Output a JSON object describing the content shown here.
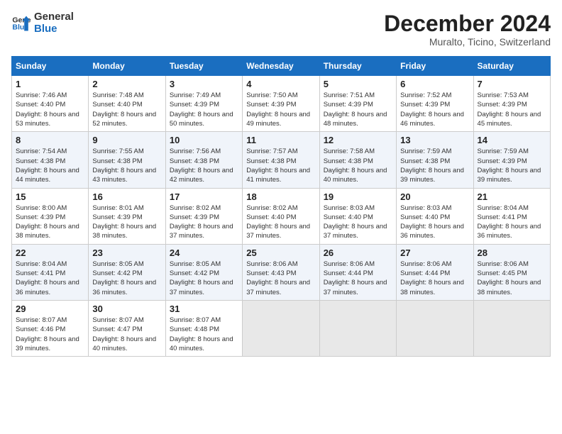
{
  "header": {
    "logo_line1": "General",
    "logo_line2": "Blue",
    "month": "December 2024",
    "location": "Muralto, Ticino, Switzerland"
  },
  "days_of_week": [
    "Sunday",
    "Monday",
    "Tuesday",
    "Wednesday",
    "Thursday",
    "Friday",
    "Saturday"
  ],
  "weeks": [
    [
      {
        "day": 1,
        "sunrise": "7:46 AM",
        "sunset": "4:40 PM",
        "daylight": "8 hours and 53 minutes."
      },
      {
        "day": 2,
        "sunrise": "7:48 AM",
        "sunset": "4:40 PM",
        "daylight": "8 hours and 52 minutes."
      },
      {
        "day": 3,
        "sunrise": "7:49 AM",
        "sunset": "4:39 PM",
        "daylight": "8 hours and 50 minutes."
      },
      {
        "day": 4,
        "sunrise": "7:50 AM",
        "sunset": "4:39 PM",
        "daylight": "8 hours and 49 minutes."
      },
      {
        "day": 5,
        "sunrise": "7:51 AM",
        "sunset": "4:39 PM",
        "daylight": "8 hours and 48 minutes."
      },
      {
        "day": 6,
        "sunrise": "7:52 AM",
        "sunset": "4:39 PM",
        "daylight": "8 hours and 46 minutes."
      },
      {
        "day": 7,
        "sunrise": "7:53 AM",
        "sunset": "4:39 PM",
        "daylight": "8 hours and 45 minutes."
      }
    ],
    [
      {
        "day": 8,
        "sunrise": "7:54 AM",
        "sunset": "4:38 PM",
        "daylight": "8 hours and 44 minutes."
      },
      {
        "day": 9,
        "sunrise": "7:55 AM",
        "sunset": "4:38 PM",
        "daylight": "8 hours and 43 minutes."
      },
      {
        "day": 10,
        "sunrise": "7:56 AM",
        "sunset": "4:38 PM",
        "daylight": "8 hours and 42 minutes."
      },
      {
        "day": 11,
        "sunrise": "7:57 AM",
        "sunset": "4:38 PM",
        "daylight": "8 hours and 41 minutes."
      },
      {
        "day": 12,
        "sunrise": "7:58 AM",
        "sunset": "4:38 PM",
        "daylight": "8 hours and 40 minutes."
      },
      {
        "day": 13,
        "sunrise": "7:59 AM",
        "sunset": "4:38 PM",
        "daylight": "8 hours and 39 minutes."
      },
      {
        "day": 14,
        "sunrise": "7:59 AM",
        "sunset": "4:39 PM",
        "daylight": "8 hours and 39 minutes."
      }
    ],
    [
      {
        "day": 15,
        "sunrise": "8:00 AM",
        "sunset": "4:39 PM",
        "daylight": "8 hours and 38 minutes."
      },
      {
        "day": 16,
        "sunrise": "8:01 AM",
        "sunset": "4:39 PM",
        "daylight": "8 hours and 38 minutes."
      },
      {
        "day": 17,
        "sunrise": "8:02 AM",
        "sunset": "4:39 PM",
        "daylight": "8 hours and 37 minutes."
      },
      {
        "day": 18,
        "sunrise": "8:02 AM",
        "sunset": "4:40 PM",
        "daylight": "8 hours and 37 minutes."
      },
      {
        "day": 19,
        "sunrise": "8:03 AM",
        "sunset": "4:40 PM",
        "daylight": "8 hours and 37 minutes."
      },
      {
        "day": 20,
        "sunrise": "8:03 AM",
        "sunset": "4:40 PM",
        "daylight": "8 hours and 36 minutes."
      },
      {
        "day": 21,
        "sunrise": "8:04 AM",
        "sunset": "4:41 PM",
        "daylight": "8 hours and 36 minutes."
      }
    ],
    [
      {
        "day": 22,
        "sunrise": "8:04 AM",
        "sunset": "4:41 PM",
        "daylight": "8 hours and 36 minutes."
      },
      {
        "day": 23,
        "sunrise": "8:05 AM",
        "sunset": "4:42 PM",
        "daylight": "8 hours and 36 minutes."
      },
      {
        "day": 24,
        "sunrise": "8:05 AM",
        "sunset": "4:42 PM",
        "daylight": "8 hours and 37 minutes."
      },
      {
        "day": 25,
        "sunrise": "8:06 AM",
        "sunset": "4:43 PM",
        "daylight": "8 hours and 37 minutes."
      },
      {
        "day": 26,
        "sunrise": "8:06 AM",
        "sunset": "4:44 PM",
        "daylight": "8 hours and 37 minutes."
      },
      {
        "day": 27,
        "sunrise": "8:06 AM",
        "sunset": "4:44 PM",
        "daylight": "8 hours and 38 minutes."
      },
      {
        "day": 28,
        "sunrise": "8:06 AM",
        "sunset": "4:45 PM",
        "daylight": "8 hours and 38 minutes."
      }
    ],
    [
      {
        "day": 29,
        "sunrise": "8:07 AM",
        "sunset": "4:46 PM",
        "daylight": "8 hours and 39 minutes."
      },
      {
        "day": 30,
        "sunrise": "8:07 AM",
        "sunset": "4:47 PM",
        "daylight": "8 hours and 40 minutes."
      },
      {
        "day": 31,
        "sunrise": "8:07 AM",
        "sunset": "4:48 PM",
        "daylight": "8 hours and 40 minutes."
      },
      null,
      null,
      null,
      null
    ]
  ]
}
